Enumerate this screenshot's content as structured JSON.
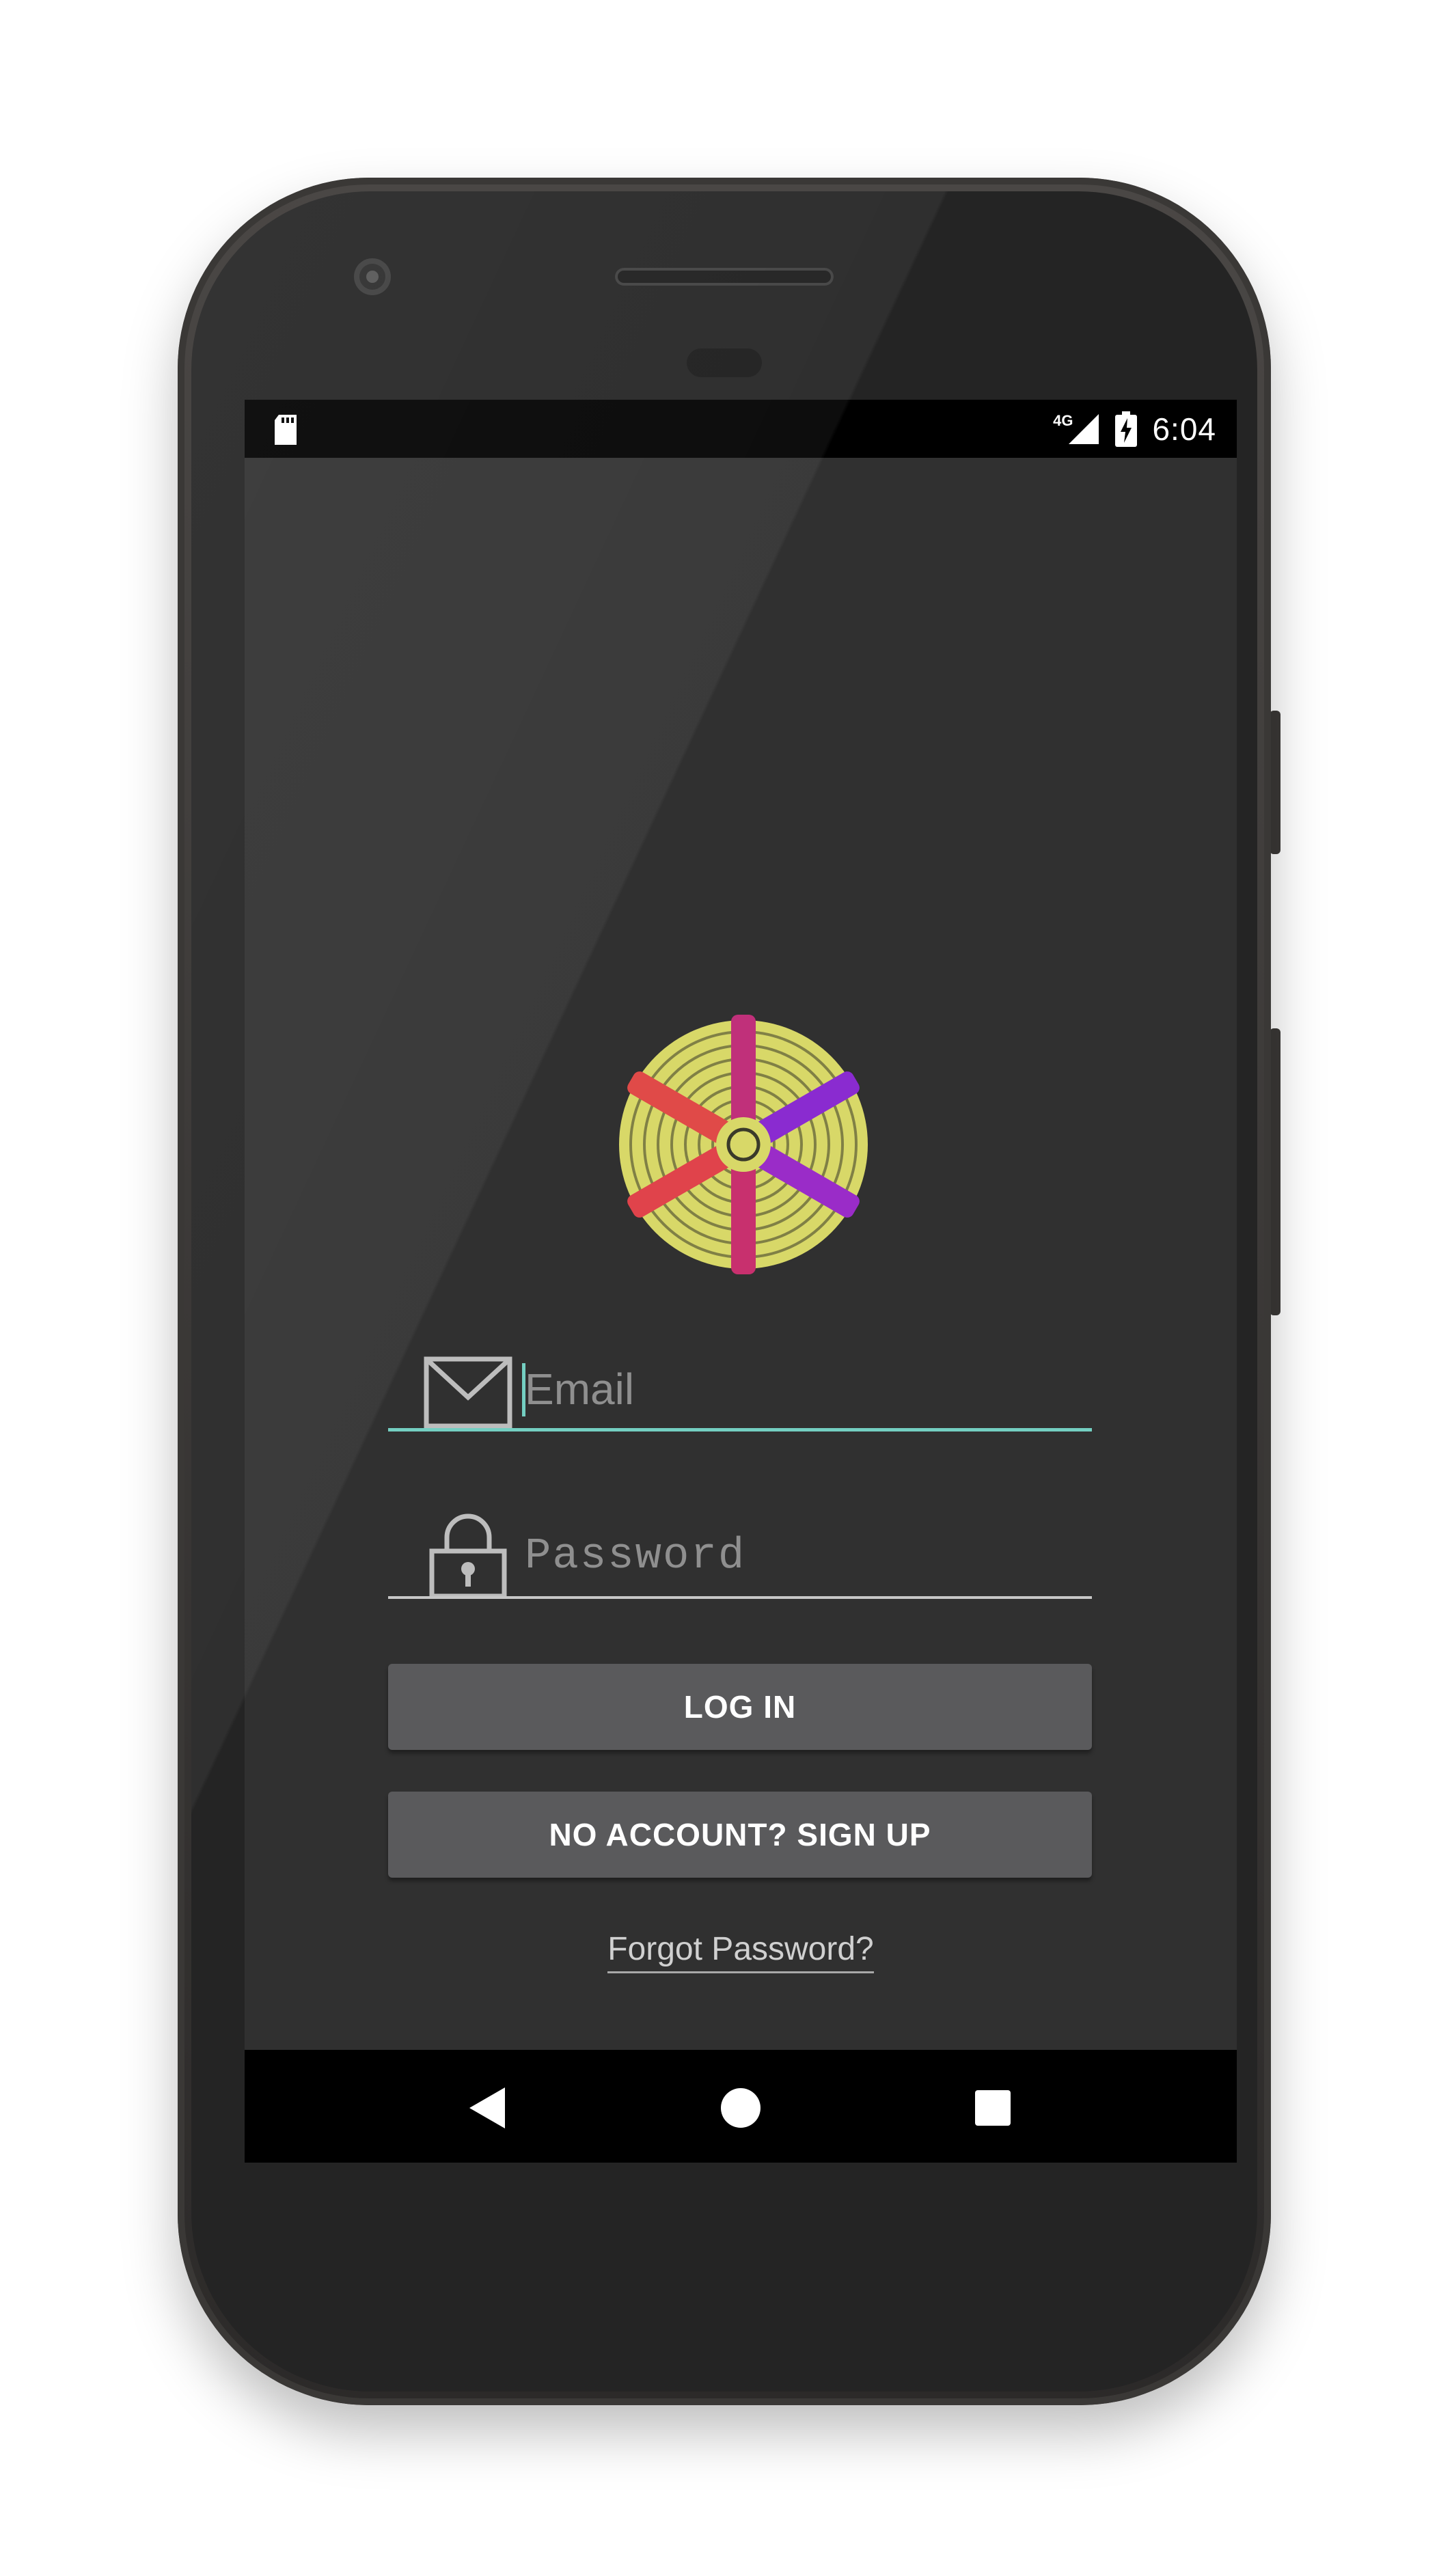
{
  "status_bar": {
    "network_type": "4G",
    "time": "6:04",
    "icons": [
      "sd-card-icon",
      "signal-icon",
      "battery-charging-icon"
    ]
  },
  "login": {
    "email_placeholder": "Email",
    "password_placeholder": "Password",
    "login_button": "LOG IN",
    "signup_button": "NO ACCOUNT? SIGN UP",
    "forgot_password": "Forgot Password?"
  },
  "colors": {
    "screen_bg": "#303030",
    "accent": "#74cfc2",
    "button_bg": "#5a5a5c",
    "logo_ring": "#d8d868",
    "logo_hand_red": "#e0434b",
    "logo_hand_magenta": "#c0307a",
    "logo_hand_purple": "#8a2bd0"
  },
  "nav_bar": {
    "icons": [
      "back-icon",
      "home-icon",
      "recents-icon"
    ]
  }
}
